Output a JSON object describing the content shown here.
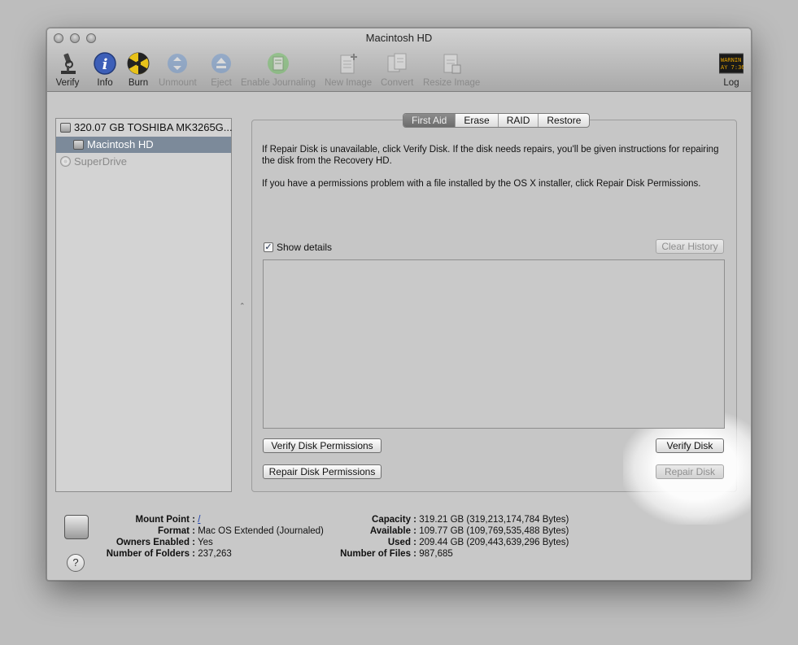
{
  "window": {
    "title": "Macintosh HD"
  },
  "toolbar": {
    "items": [
      {
        "label": "Verify",
        "icon": "microscope-icon",
        "enabled": true
      },
      {
        "label": "Info",
        "icon": "info-icon",
        "enabled": true
      },
      {
        "label": "Burn",
        "icon": "burn-icon",
        "enabled": true
      },
      {
        "label": "Unmount",
        "icon": "unmount-icon",
        "enabled": false
      },
      {
        "label": "Eject",
        "icon": "eject-icon",
        "enabled": false
      },
      {
        "label": "Enable Journaling",
        "icon": "journal-icon",
        "enabled": false
      },
      {
        "label": "New Image",
        "icon": "new-image-icon",
        "enabled": false
      },
      {
        "label": "Convert",
        "icon": "convert-icon",
        "enabled": false
      },
      {
        "label": "Resize Image",
        "icon": "resize-image-icon",
        "enabled": false
      }
    ],
    "log": {
      "label": "Log",
      "screen_text_1": "WARNIN",
      "screen_text_2": "AY 7:36"
    }
  },
  "sidebar": {
    "items": [
      {
        "label": "320.07 GB TOSHIBA MK3265G...",
        "selected": false,
        "enabled": true
      },
      {
        "label": "Macintosh HD",
        "selected": true,
        "enabled": true
      },
      {
        "label": "SuperDrive",
        "selected": false,
        "enabled": false
      }
    ]
  },
  "tabs": [
    {
      "label": "First Aid",
      "active": true
    },
    {
      "label": "Erase",
      "active": false
    },
    {
      "label": "RAID",
      "active": false
    },
    {
      "label": "Restore",
      "active": false
    }
  ],
  "first_aid": {
    "info_1": "If Repair Disk is unavailable, click Verify Disk. If the disk needs repairs, you'll be given instructions for repairing the disk from the Recovery HD.",
    "info_2": "If you have a permissions problem with a file installed by the OS X installer, click Repair Disk Permissions.",
    "show_details_label": "Show details",
    "show_details_checked": true,
    "clear_history_label": "Clear History",
    "verify_permissions_label": "Verify Disk Permissions",
    "repair_permissions_label": "Repair Disk Permissions",
    "verify_disk_label": "Verify Disk",
    "repair_disk_label": "Repair Disk"
  },
  "disk_info": {
    "left": [
      {
        "key": "Mount Point :",
        "value": "/"
      },
      {
        "key": "Format :",
        "value": "Mac OS Extended (Journaled)"
      },
      {
        "key": "Owners Enabled :",
        "value": "Yes"
      },
      {
        "key": "Number of Folders :",
        "value": "237,263"
      }
    ],
    "right": [
      {
        "key": "Capacity :",
        "value": "319.21 GB (319,213,174,784 Bytes)"
      },
      {
        "key": "Available :",
        "value": "109.77 GB (109,769,535,488 Bytes)"
      },
      {
        "key": "Used :",
        "value": "209.44 GB (209,443,639,296 Bytes)"
      },
      {
        "key": "Number of Files :",
        "value": "987,685"
      }
    ],
    "help_label": "?"
  }
}
